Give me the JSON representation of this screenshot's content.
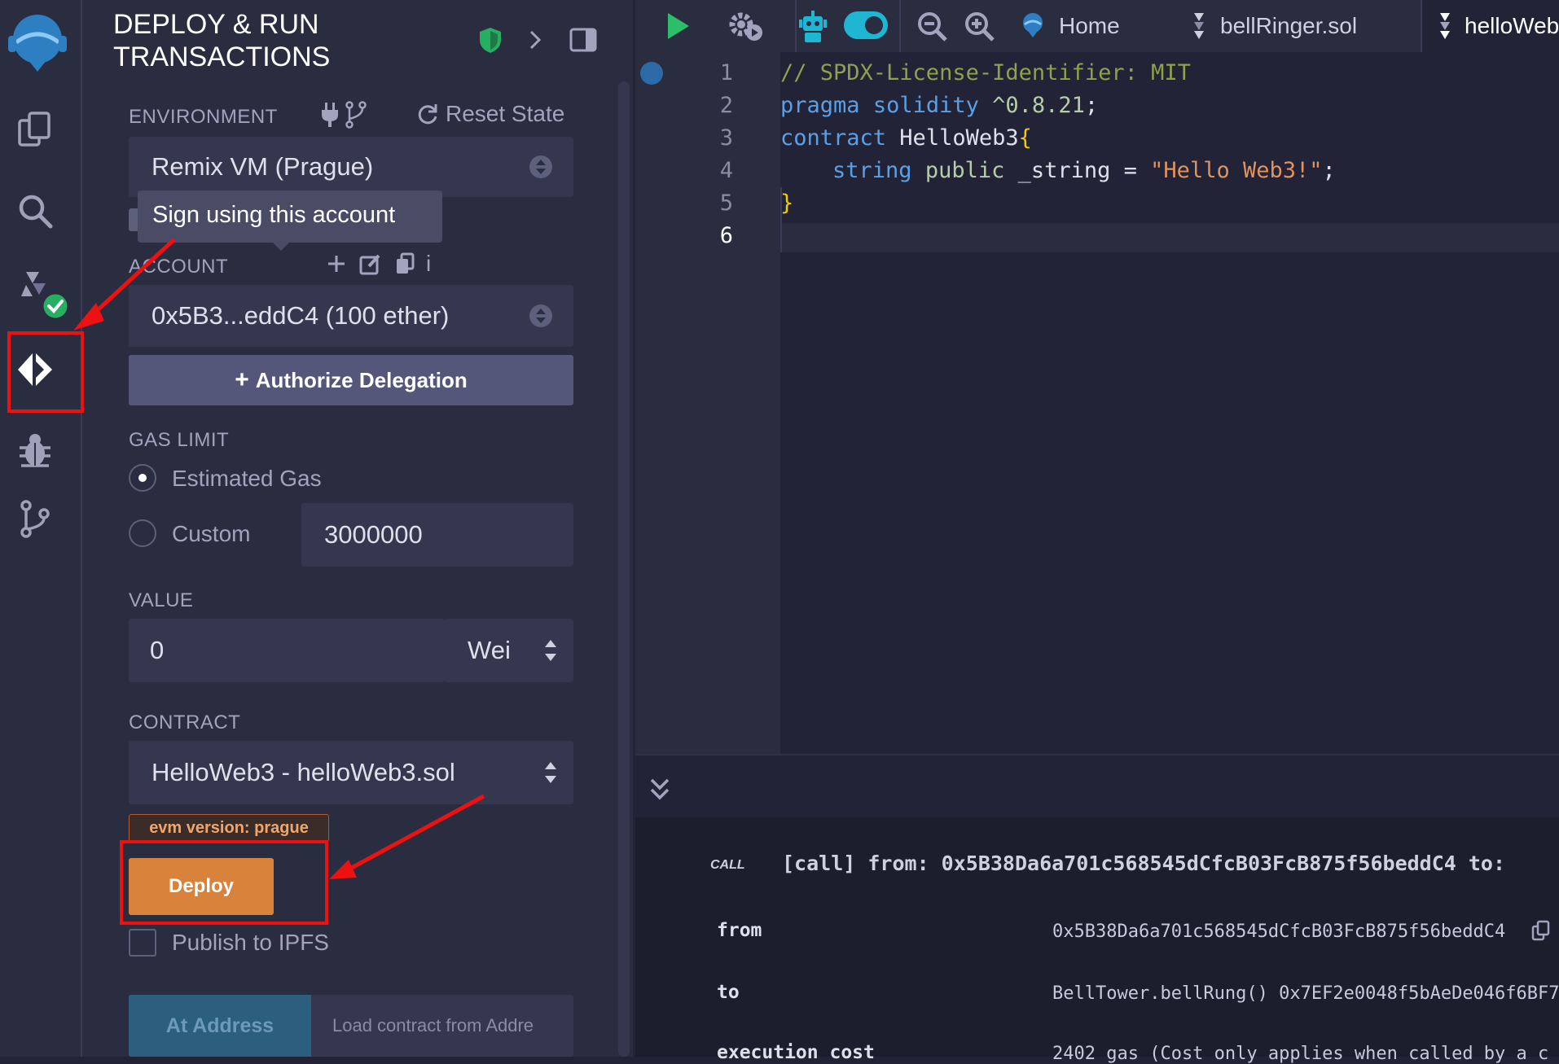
{
  "panel": {
    "title_line1": "DEPLOY & RUN",
    "title_line2": "TRANSACTIONS",
    "environment_label": "ENVIRONMENT",
    "reset_state_label": "Reset State",
    "environment_value": "Remix VM (Prague)",
    "tooltip": "Sign using this account",
    "account_label": "ACCOUNT",
    "account_info": "i",
    "account_value": "0x5B3...eddC4 (100 ether)",
    "authorize_button": "Authorize Delegation",
    "gas_limit_label": "GAS LIMIT",
    "gas_estimated_label": "Estimated Gas",
    "gas_custom_label": "Custom",
    "gas_custom_value": "3000000",
    "value_label": "VALUE",
    "value_amount": "0",
    "value_unit": "Wei",
    "contract_label": "CONTRACT",
    "contract_value": "HelloWeb3 - helloWeb3.sol",
    "evm_badge": "evm version: prague",
    "deploy_button": "Deploy",
    "publish_label": "Publish to IPFS",
    "at_address_button": "At Address",
    "load_contract_placeholder": "Load contract from Addre"
  },
  "topbar": {
    "home_tab": "Home",
    "tab1": "bellRinger.sol",
    "tab2": "helloWeb"
  },
  "editor": {
    "line_numbers": [
      "1",
      "2",
      "3",
      "4",
      "5",
      "6"
    ],
    "line1": "// SPDX-License-Identifier: MIT",
    "line2_kw1": "pragma",
    "line2_kw2": "solidity",
    "line2_ver": "^0.8.21",
    "line2_end": ";",
    "line3_kw": "contract",
    "line3_name": " HelloWeb3",
    "line3_brace": "{",
    "line4_kw1": "string",
    "line4_kw2": "public",
    "line4_name": " _string = ",
    "line4_str": "\"Hello Web3!\"",
    "line4_end": ";",
    "line5_brace": "}"
  },
  "terminal": {
    "call_tag": "CALL",
    "call_line": "[call]  from: 0x5B38Da6a701c568545dCfcB03FcB875f56beddC4 to:",
    "from_key": "from",
    "from_value": "0x5B38Da6a701c568545dCfcB03FcB875f56beddC4",
    "to_key": "to",
    "to_value": "BellTower.bellRung() 0x7EF2e0048f5bAeDe046f6BF7",
    "cost_key": "execution cost",
    "cost_value": "2402 gas (Cost only applies when called by a c"
  },
  "colors": {
    "deploy": "#d9823b",
    "accent_teal": "#1fb6d4",
    "annotation_red": "#ee1111"
  }
}
